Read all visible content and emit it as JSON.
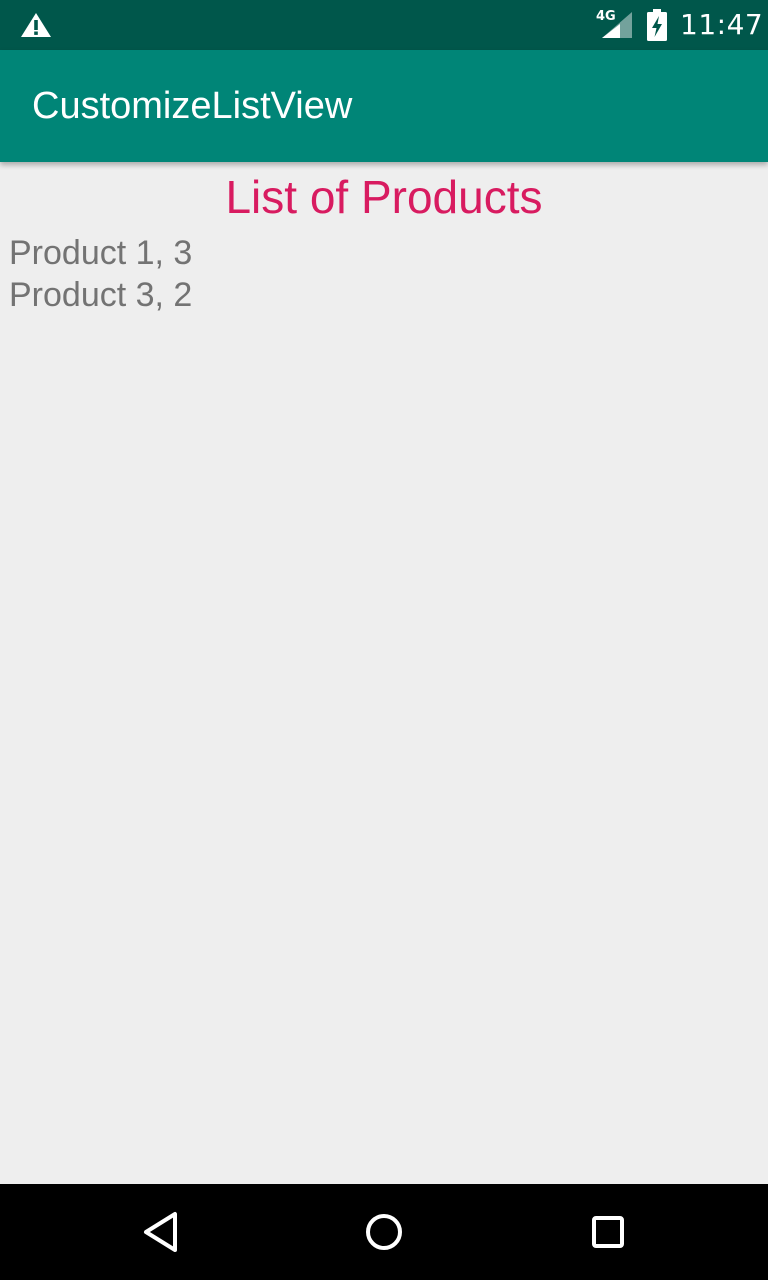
{
  "status_bar": {
    "warning_icon": "warning-icon",
    "network_type": "4G",
    "signal_icon": "cell-signal-icon",
    "battery_icon": "battery-charging-icon",
    "time": "11:47",
    "background_color": "#00574b"
  },
  "app_bar": {
    "title": "CustomizeListView",
    "background_color": "#008577"
  },
  "main": {
    "heading": "List of Products",
    "heading_color": "#d81b60",
    "products": [
      {
        "label": "Product 1, 3"
      },
      {
        "label": "Product 3, 2"
      }
    ]
  },
  "nav_bar": {
    "back_icon": "back-triangle-icon",
    "home_icon": "home-circle-icon",
    "recents_icon": "recents-square-icon"
  }
}
